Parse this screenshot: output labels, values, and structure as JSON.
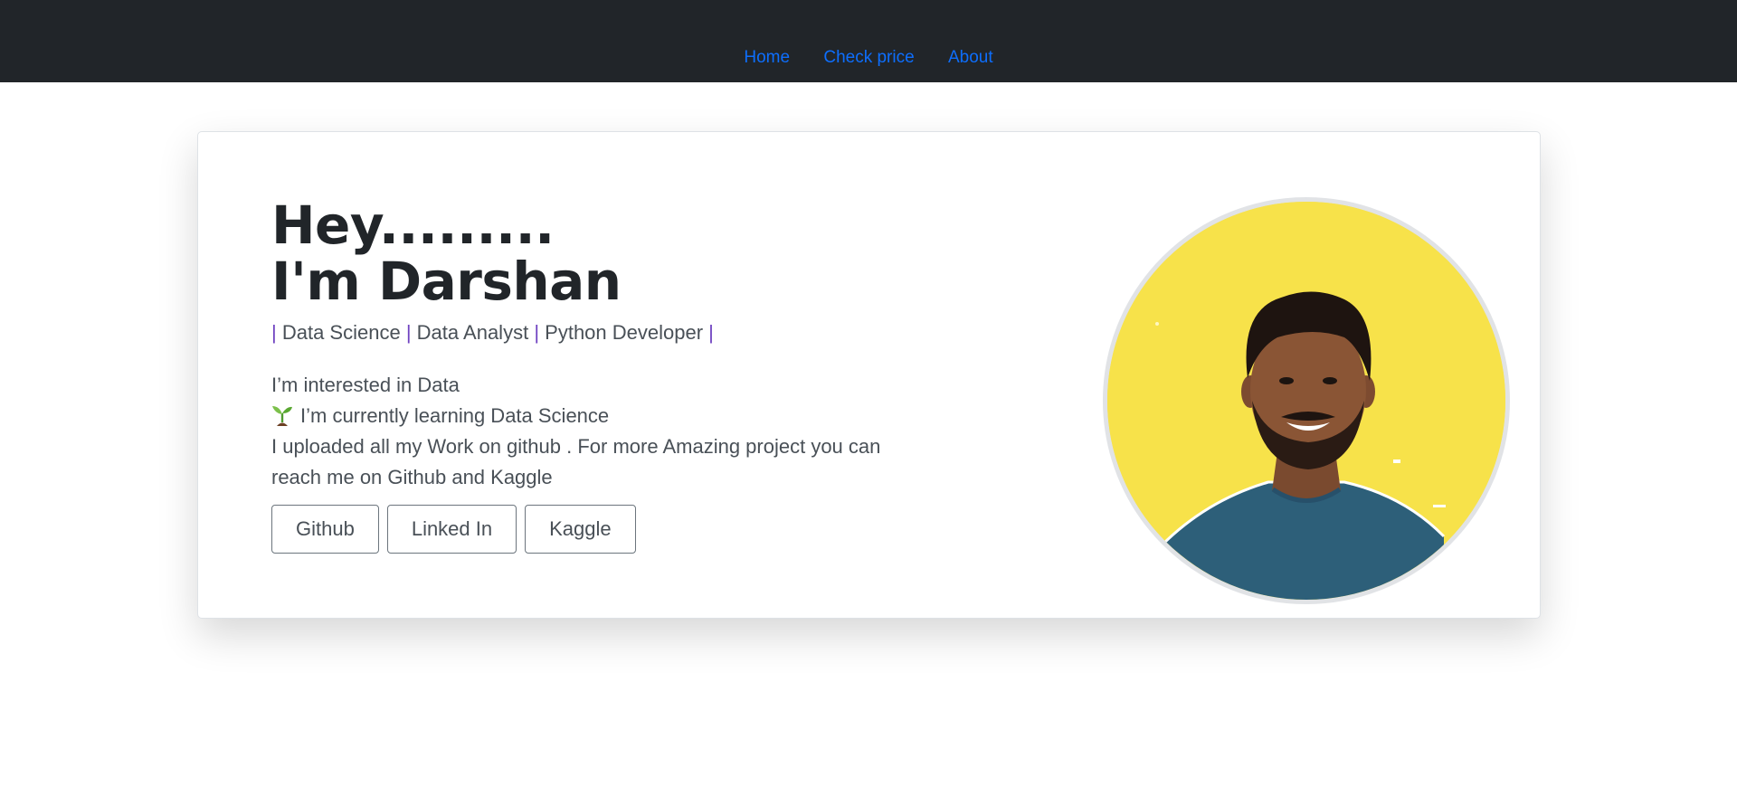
{
  "nav": {
    "items": [
      {
        "label": "Home"
      },
      {
        "label": "Check price"
      },
      {
        "label": "About"
      }
    ]
  },
  "hero": {
    "greeting": "Hey.........",
    "name_line": "I'm Darshan",
    "subtitle": {
      "roles": [
        "Data Science",
        "Data Analyst",
        "Python Developer"
      ],
      "separator": "|"
    },
    "bio": {
      "line1": "I’m interested in Data",
      "line2_icon": "seedling-icon",
      "line2": "I’m currently learning Data Science",
      "line3": "I uploaded all my Work on github . For more Amazing project you can reach me on Github and Kaggle"
    },
    "buttons": [
      {
        "label": "Github"
      },
      {
        "label": "Linked In"
      },
      {
        "label": "Kaggle"
      }
    ]
  },
  "colors": {
    "navbar_bg": "#212529",
    "link": "#0d6efd",
    "avatar_bg": "#f7e24a"
  }
}
